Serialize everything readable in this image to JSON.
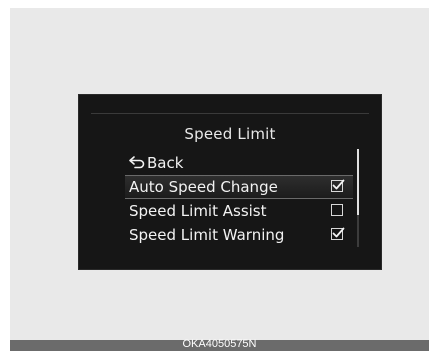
{
  "menu": {
    "title": "Speed Limit",
    "back_label": "Back",
    "items": [
      {
        "label": "Auto Speed Change",
        "checked": true,
        "selected": true
      },
      {
        "label": "Speed Limit Assist",
        "checked": false,
        "selected": false
      },
      {
        "label": "Speed Limit Warning",
        "checked": true,
        "selected": false
      }
    ]
  },
  "scrollbar": {
    "visible_fraction": 0.67
  },
  "caption": "OKA4050575N",
  "icons": {
    "back": "back-arrow-icon",
    "check": "checkmark-icon"
  },
  "colors": {
    "screen_background": "#161616",
    "text": "#f2f2f2",
    "caption_bar": "#6b6b6b"
  }
}
